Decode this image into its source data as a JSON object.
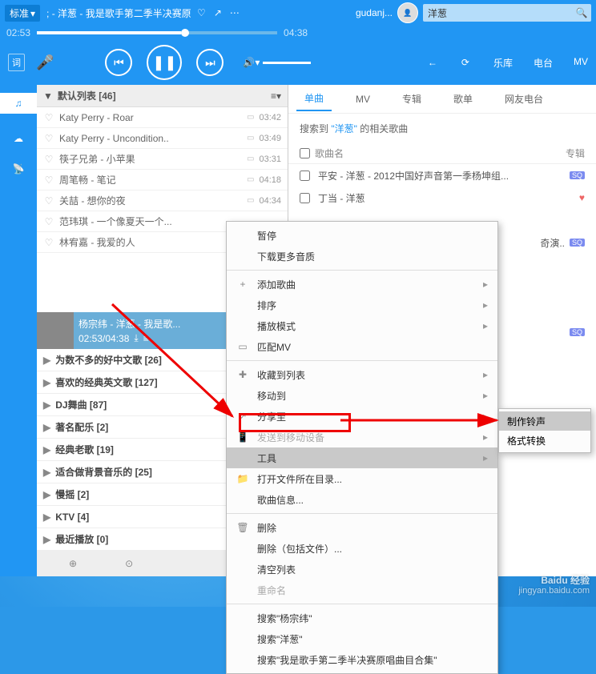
{
  "top": {
    "quality": "标准",
    "marquee": "; - 洋葱 - 我是歌手第二季半决赛原",
    "username": "gudanj...",
    "search": "洋葱"
  },
  "time": {
    "cur": "02:53",
    "total": "04:38"
  },
  "lyric_btn": "词",
  "nav": {
    "back": "←",
    "reload": "⟳",
    "tabs": [
      "乐库",
      "电台",
      "MV"
    ]
  },
  "rail": [
    "♫",
    "☁",
    "📡"
  ],
  "playlist": {
    "header": "默认列表 [46]",
    "songs": [
      {
        "name": "Katy Perry - Roar",
        "dur": "03:42",
        "mv": true,
        "icon": "♡"
      },
      {
        "name": "Katy Perry - Uncondition..",
        "dur": "03:49",
        "mv": true,
        "icon": "♡"
      },
      {
        "name": "筷子兄弟 - 小苹果",
        "dur": "03:31",
        "mv": true,
        "icon": "♡"
      },
      {
        "name": "周笔畅 - 笔记",
        "dur": "04:18",
        "mv": true,
        "icon": "♡"
      },
      {
        "name": "关喆 - 想你的夜",
        "dur": "04:34",
        "mv": true,
        "icon": "♡"
      },
      {
        "name": "范玮琪 - 一个像夏天一个...",
        "dur": "",
        "mv": false,
        "icon": "♡"
      },
      {
        "name": "林宥嘉 - 我爱的人",
        "dur": "",
        "mv": false,
        "icon": "♡"
      }
    ],
    "np": {
      "title": "杨宗纬 - 洋葱 - 我是歌...",
      "time": "02:53/04:38"
    },
    "folders": [
      "为数不多的好中文歌 [26]",
      "喜欢的经典英文歌 [127]",
      "DJ舞曲 [87]",
      "著名配乐 [2]",
      "经典老歌 [19]",
      "适合做背景音乐的 [25]",
      "慢摇 [2]",
      "KTV [4]",
      "最近播放 [0]"
    ]
  },
  "search": {
    "tabs": [
      "单曲",
      "MV",
      "专辑",
      "歌单",
      "网友电台"
    ],
    "hint_pre": "搜索到",
    "hint_kw": "\"洋葱\"",
    "hint_post": "的相关歌曲",
    "head": {
      "name": "歌曲名",
      "album": "专辑"
    },
    "rows": [
      {
        "name": "平安 - 洋葱 - 2012中国好声音第一季杨坤组...",
        "sq": true
      },
      {
        "name": "丁当 - 洋葱",
        "sq": false,
        "heart": true
      },
      {
        "name": "",
        "hidden": true
      },
      {
        "name": "",
        "tail": "奇演..",
        "sq": true
      },
      {
        "name": "",
        "hidden": true
      },
      {
        "name": "",
        "hidden": true
      },
      {
        "name": "",
        "hidden": true
      },
      {
        "name": "",
        "sq": true
      }
    ]
  },
  "ctx": {
    "items": [
      {
        "t": "暂停"
      },
      {
        "t": "下载更多音质"
      },
      {
        "sep": true
      },
      {
        "t": "添加歌曲",
        "arrow": true,
        "icon": "+"
      },
      {
        "t": "排序",
        "arrow": true
      },
      {
        "t": "播放模式",
        "arrow": true
      },
      {
        "t": "匹配MV",
        "icon": "▭"
      },
      {
        "sep": true
      },
      {
        "t": "收藏到列表",
        "arrow": true,
        "icon": "✚"
      },
      {
        "t": "移动到",
        "arrow": true
      },
      {
        "t": "分享至",
        "arrow": true,
        "icon": "↗"
      },
      {
        "t": "发送到移动设备",
        "arrow": true,
        "icon": "📱",
        "disabled": true
      },
      {
        "t": "工具",
        "arrow": true,
        "hl": true
      },
      {
        "t": "打开文件所在目录...",
        "icon": "📁"
      },
      {
        "t": "歌曲信息...",
        "icon": ""
      },
      {
        "sep": true
      },
      {
        "t": "删除",
        "icon": "🗑"
      },
      {
        "t": "删除（包括文件）..."
      },
      {
        "t": "清空列表"
      },
      {
        "t": "重命名",
        "disabled": true
      },
      {
        "sep": true
      },
      {
        "t": "搜索\"杨宗纬\""
      },
      {
        "t": "搜索\"洋葱\""
      },
      {
        "t": "搜索\"我是歌手第二季半决赛原唱曲目合集\""
      }
    ]
  },
  "submenu": {
    "items": [
      {
        "t": "制作铃声",
        "hl": true
      },
      {
        "t": "格式转换"
      }
    ]
  },
  "watermark": {
    "main": "Baidu 经验",
    "sub": "jingyan.baidu.com"
  }
}
